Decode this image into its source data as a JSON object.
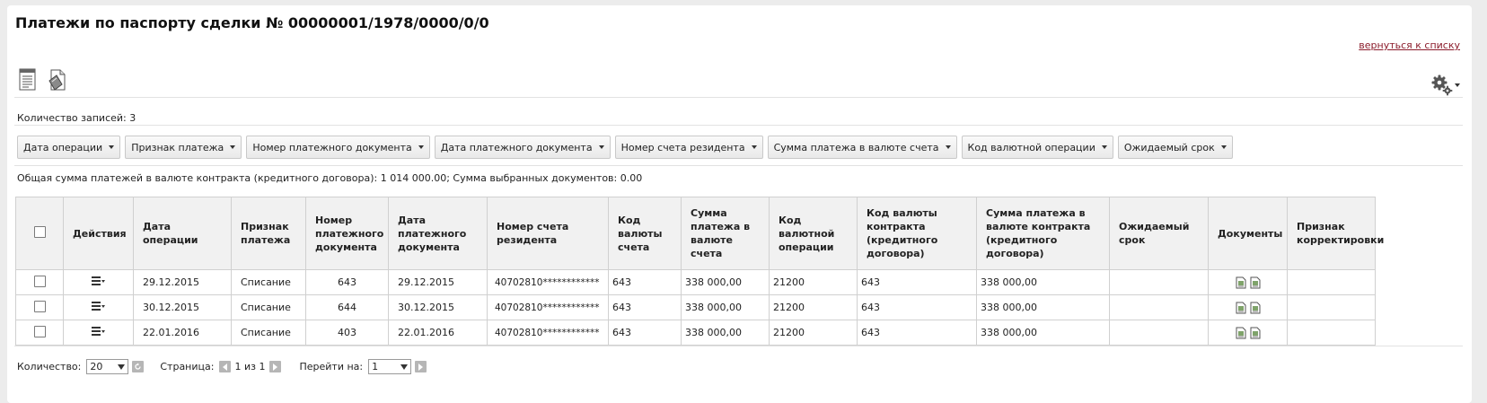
{
  "page": {
    "title": "Платежи по паспорту сделки № 00000001/1978/0000/0/0",
    "back_link": "вернуться к списку"
  },
  "toolbar": {
    "icons": [
      "report-icon",
      "export-icon",
      "gear-icon"
    ]
  },
  "records_count": "Количество записей: 3",
  "filters": [
    "Дата операции",
    "Признак платежа",
    "Номер платежного документа",
    "Дата платежного документа",
    "Номер счета резидента",
    "Сумма платежа в валюте счета",
    "Код валютной операции",
    "Ожидаемый срок"
  ],
  "summary": "Общая сумма платежей в валюте контракта (кредитного договора): 1 014 000.00; Сумма выбранных документов: 0.00",
  "table": {
    "headers": {
      "actions": "Действия",
      "op_date": "Дата операции",
      "sign": "Признак платежа",
      "doc_num": "Номер платежного документа",
      "doc_date": "Дата платежного документа",
      "account": "Номер счета резидента",
      "acc_currency": "Код валюты счета",
      "amount_acc": "Сумма платежа в валюте счета",
      "op_code": "Код валютной операции",
      "contract_currency": "Код валюты контракта (кредитного договора)",
      "amount_contract": "Сумма платежа в валюте контракта (кредитного договора)",
      "expected": "Ожидаемый срок",
      "documents": "Документы",
      "correction": "Признак корректировки"
    },
    "rows": [
      {
        "op_date": "29.12.2015",
        "sign": "Списание",
        "doc_num": "643",
        "doc_date": "29.12.2015",
        "account": "40702810************",
        "acc_currency": "643",
        "amount_acc": "338 000,00",
        "op_code": "21200",
        "contract_currency": "643",
        "amount_contract": "338 000,00"
      },
      {
        "op_date": "30.12.2015",
        "sign": "Списание",
        "doc_num": "644",
        "doc_date": "30.12.2015",
        "account": "40702810************",
        "acc_currency": "643",
        "amount_acc": "338 000,00",
        "op_code": "21200",
        "contract_currency": "643",
        "amount_contract": "338 000,00"
      },
      {
        "op_date": "22.01.2016",
        "sign": "Списание",
        "doc_num": "403",
        "doc_date": "22.01.2016",
        "account": "40702810************",
        "acc_currency": "643",
        "amount_acc": "338 000,00",
        "op_code": "21200",
        "contract_currency": "643",
        "amount_contract": "338 000,00"
      }
    ]
  },
  "pager": {
    "count_label": "Количество:",
    "count_value": "20",
    "page_label": "Страница:",
    "page_info": "1 из 1",
    "goto_label": "Перейти на:",
    "goto_value": "1"
  }
}
